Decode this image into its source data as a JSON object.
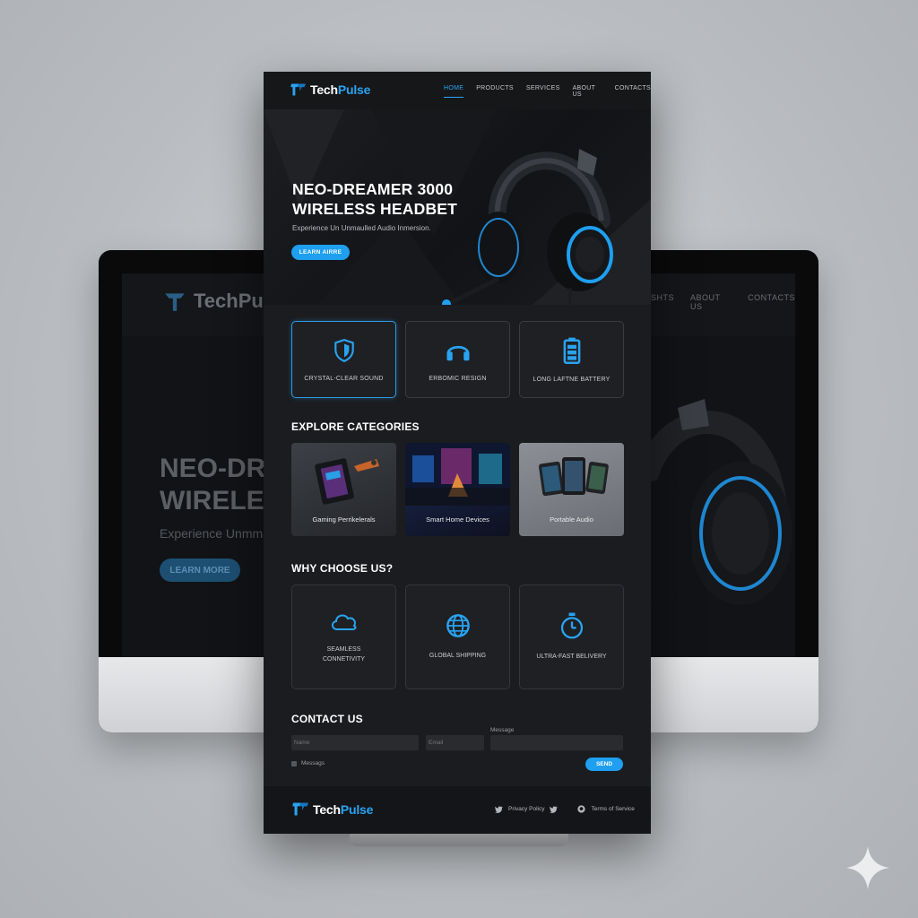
{
  "brand": {
    "name_prefix": "Tech",
    "name_suffix": "Pulse",
    "accent": "#29a3f0"
  },
  "nav": {
    "items": [
      "HOME",
      "PRODUCTS",
      "SERVICES",
      "ABOUT US",
      "CONTACTS"
    ],
    "active": "HOME"
  },
  "hero": {
    "title_line1": "NEO-DREAMER 3000",
    "title_line2": "WIRELESS HEADBET",
    "subtitle": "Experience Un Unmaulled Audio Inmersion.",
    "button": "LEARN AIRRE",
    "image_icon": "headset-image"
  },
  "features": [
    {
      "label": "CRYSTAL-CLEAR SOUND",
      "icon": "shield-icon",
      "active": true
    },
    {
      "label": "ERBOMIC RESIGN",
      "icon": "headphones-icon",
      "active": false
    },
    {
      "label": "LONG LAFTNE BATTERY",
      "icon": "battery-icon",
      "active": false
    }
  ],
  "categories": {
    "title": "EXPLORE CATEGORIES",
    "items": [
      {
        "label": "Gaming Perrikelerals",
        "icon": "gaming-image"
      },
      {
        "label": "Smart Home Devices",
        "icon": "smart-home-image"
      },
      {
        "label": "Portable Audio",
        "icon": "tablets-image"
      }
    ]
  },
  "why": {
    "title": "WHY CHOOSE US?",
    "items": [
      {
        "label": "SEAMLESS CONNETIVITY",
        "icon": "cloud-icon"
      },
      {
        "label": "GLOBAL SHIPPING",
        "icon": "globe-icon"
      },
      {
        "label": "ULTRA-FAST BELIVERY",
        "icon": "stopwatch-icon"
      }
    ]
  },
  "contact": {
    "title": "CONTACT US",
    "name_placeholder": "Name",
    "email_placeholder": "Email",
    "message_label": "Message",
    "checkbox_label": "Messags",
    "send": "SEND"
  },
  "footer": {
    "privacy": "Privacy Policy",
    "terms": "Terms of Service",
    "social_icons": [
      "twitter-icon",
      "twitter-icon",
      "github-icon"
    ]
  },
  "background_monitor": {
    "logo_text": "TechPu",
    "nav_items": [
      "SHTS",
      "ABOUT US",
      "CONTACTS"
    ],
    "hero_line1": "NEO-DR",
    "hero_line2": "WIRELESS",
    "hero_sub": "Experience Unmmall",
    "button": "LEARN MORE"
  }
}
